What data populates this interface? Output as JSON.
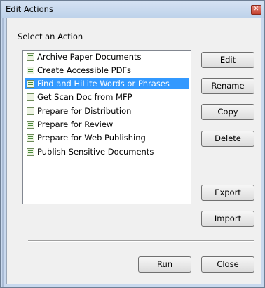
{
  "window": {
    "title": "Edit Actions",
    "close_glyph": "✕"
  },
  "select_label": "Select an Action",
  "actions": [
    {
      "label": "Archive Paper Documents",
      "selected": false
    },
    {
      "label": "Create Accessible PDFs",
      "selected": false
    },
    {
      "label": "Find and HiLite Words or Phrases",
      "selected": true
    },
    {
      "label": "Get Scan Doc from MFP",
      "selected": false
    },
    {
      "label": "Prepare for Distribution",
      "selected": false
    },
    {
      "label": "Prepare for Review",
      "selected": false
    },
    {
      "label": "Prepare for Web Publishing",
      "selected": false
    },
    {
      "label": "Publish Sensitive Documents",
      "selected": false
    }
  ],
  "buttons": {
    "edit": "Edit",
    "rename": "Rename",
    "copy": "Copy",
    "delete": "Delete",
    "export": "Export",
    "import": "Import",
    "run": "Run",
    "close": "Close"
  },
  "icons": {
    "action_item": "action-sequence-icon",
    "close": "close-icon"
  },
  "colors": {
    "selection": "#3399ff",
    "frame": "#c9d9ee",
    "close_button": "#c3412f"
  }
}
